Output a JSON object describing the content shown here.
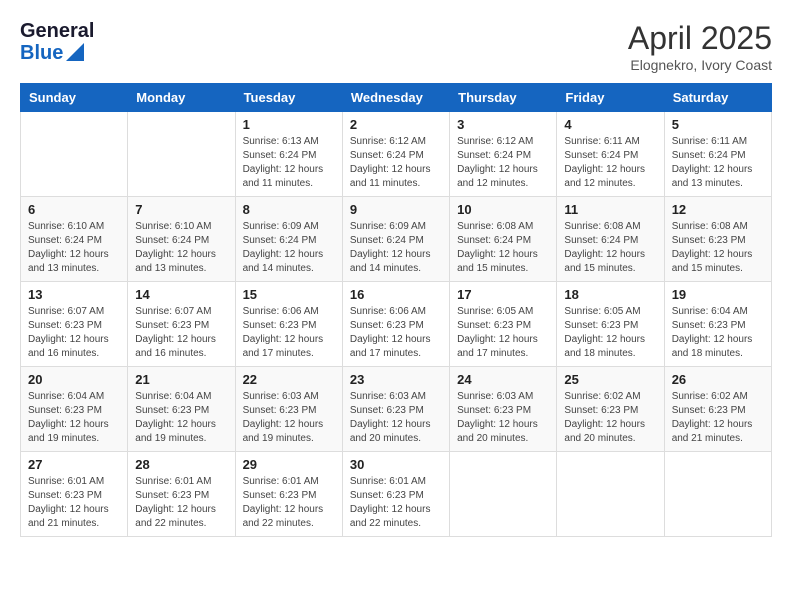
{
  "header": {
    "logo_general": "General",
    "logo_blue": "Blue",
    "title": "April 2025",
    "location": "Elognekro, Ivory Coast"
  },
  "calendar": {
    "days_of_week": [
      "Sunday",
      "Monday",
      "Tuesday",
      "Wednesday",
      "Thursday",
      "Friday",
      "Saturday"
    ],
    "weeks": [
      [
        {
          "day": "",
          "info": ""
        },
        {
          "day": "",
          "info": ""
        },
        {
          "day": "1",
          "info": "Sunrise: 6:13 AM\nSunset: 6:24 PM\nDaylight: 12 hours and 11 minutes."
        },
        {
          "day": "2",
          "info": "Sunrise: 6:12 AM\nSunset: 6:24 PM\nDaylight: 12 hours and 11 minutes."
        },
        {
          "day": "3",
          "info": "Sunrise: 6:12 AM\nSunset: 6:24 PM\nDaylight: 12 hours and 12 minutes."
        },
        {
          "day": "4",
          "info": "Sunrise: 6:11 AM\nSunset: 6:24 PM\nDaylight: 12 hours and 12 minutes."
        },
        {
          "day": "5",
          "info": "Sunrise: 6:11 AM\nSunset: 6:24 PM\nDaylight: 12 hours and 13 minutes."
        }
      ],
      [
        {
          "day": "6",
          "info": "Sunrise: 6:10 AM\nSunset: 6:24 PM\nDaylight: 12 hours and 13 minutes."
        },
        {
          "day": "7",
          "info": "Sunrise: 6:10 AM\nSunset: 6:24 PM\nDaylight: 12 hours and 13 minutes."
        },
        {
          "day": "8",
          "info": "Sunrise: 6:09 AM\nSunset: 6:24 PM\nDaylight: 12 hours and 14 minutes."
        },
        {
          "day": "9",
          "info": "Sunrise: 6:09 AM\nSunset: 6:24 PM\nDaylight: 12 hours and 14 minutes."
        },
        {
          "day": "10",
          "info": "Sunrise: 6:08 AM\nSunset: 6:24 PM\nDaylight: 12 hours and 15 minutes."
        },
        {
          "day": "11",
          "info": "Sunrise: 6:08 AM\nSunset: 6:24 PM\nDaylight: 12 hours and 15 minutes."
        },
        {
          "day": "12",
          "info": "Sunrise: 6:08 AM\nSunset: 6:23 PM\nDaylight: 12 hours and 15 minutes."
        }
      ],
      [
        {
          "day": "13",
          "info": "Sunrise: 6:07 AM\nSunset: 6:23 PM\nDaylight: 12 hours and 16 minutes."
        },
        {
          "day": "14",
          "info": "Sunrise: 6:07 AM\nSunset: 6:23 PM\nDaylight: 12 hours and 16 minutes."
        },
        {
          "day": "15",
          "info": "Sunrise: 6:06 AM\nSunset: 6:23 PM\nDaylight: 12 hours and 17 minutes."
        },
        {
          "day": "16",
          "info": "Sunrise: 6:06 AM\nSunset: 6:23 PM\nDaylight: 12 hours and 17 minutes."
        },
        {
          "day": "17",
          "info": "Sunrise: 6:05 AM\nSunset: 6:23 PM\nDaylight: 12 hours and 17 minutes."
        },
        {
          "day": "18",
          "info": "Sunrise: 6:05 AM\nSunset: 6:23 PM\nDaylight: 12 hours and 18 minutes."
        },
        {
          "day": "19",
          "info": "Sunrise: 6:04 AM\nSunset: 6:23 PM\nDaylight: 12 hours and 18 minutes."
        }
      ],
      [
        {
          "day": "20",
          "info": "Sunrise: 6:04 AM\nSunset: 6:23 PM\nDaylight: 12 hours and 19 minutes."
        },
        {
          "day": "21",
          "info": "Sunrise: 6:04 AM\nSunset: 6:23 PM\nDaylight: 12 hours and 19 minutes."
        },
        {
          "day": "22",
          "info": "Sunrise: 6:03 AM\nSunset: 6:23 PM\nDaylight: 12 hours and 19 minutes."
        },
        {
          "day": "23",
          "info": "Sunrise: 6:03 AM\nSunset: 6:23 PM\nDaylight: 12 hours and 20 minutes."
        },
        {
          "day": "24",
          "info": "Sunrise: 6:03 AM\nSunset: 6:23 PM\nDaylight: 12 hours and 20 minutes."
        },
        {
          "day": "25",
          "info": "Sunrise: 6:02 AM\nSunset: 6:23 PM\nDaylight: 12 hours and 20 minutes."
        },
        {
          "day": "26",
          "info": "Sunrise: 6:02 AM\nSunset: 6:23 PM\nDaylight: 12 hours and 21 minutes."
        }
      ],
      [
        {
          "day": "27",
          "info": "Sunrise: 6:01 AM\nSunset: 6:23 PM\nDaylight: 12 hours and 21 minutes."
        },
        {
          "day": "28",
          "info": "Sunrise: 6:01 AM\nSunset: 6:23 PM\nDaylight: 12 hours and 22 minutes."
        },
        {
          "day": "29",
          "info": "Sunrise: 6:01 AM\nSunset: 6:23 PM\nDaylight: 12 hours and 22 minutes."
        },
        {
          "day": "30",
          "info": "Sunrise: 6:01 AM\nSunset: 6:23 PM\nDaylight: 12 hours and 22 minutes."
        },
        {
          "day": "",
          "info": ""
        },
        {
          "day": "",
          "info": ""
        },
        {
          "day": "",
          "info": ""
        }
      ]
    ]
  }
}
